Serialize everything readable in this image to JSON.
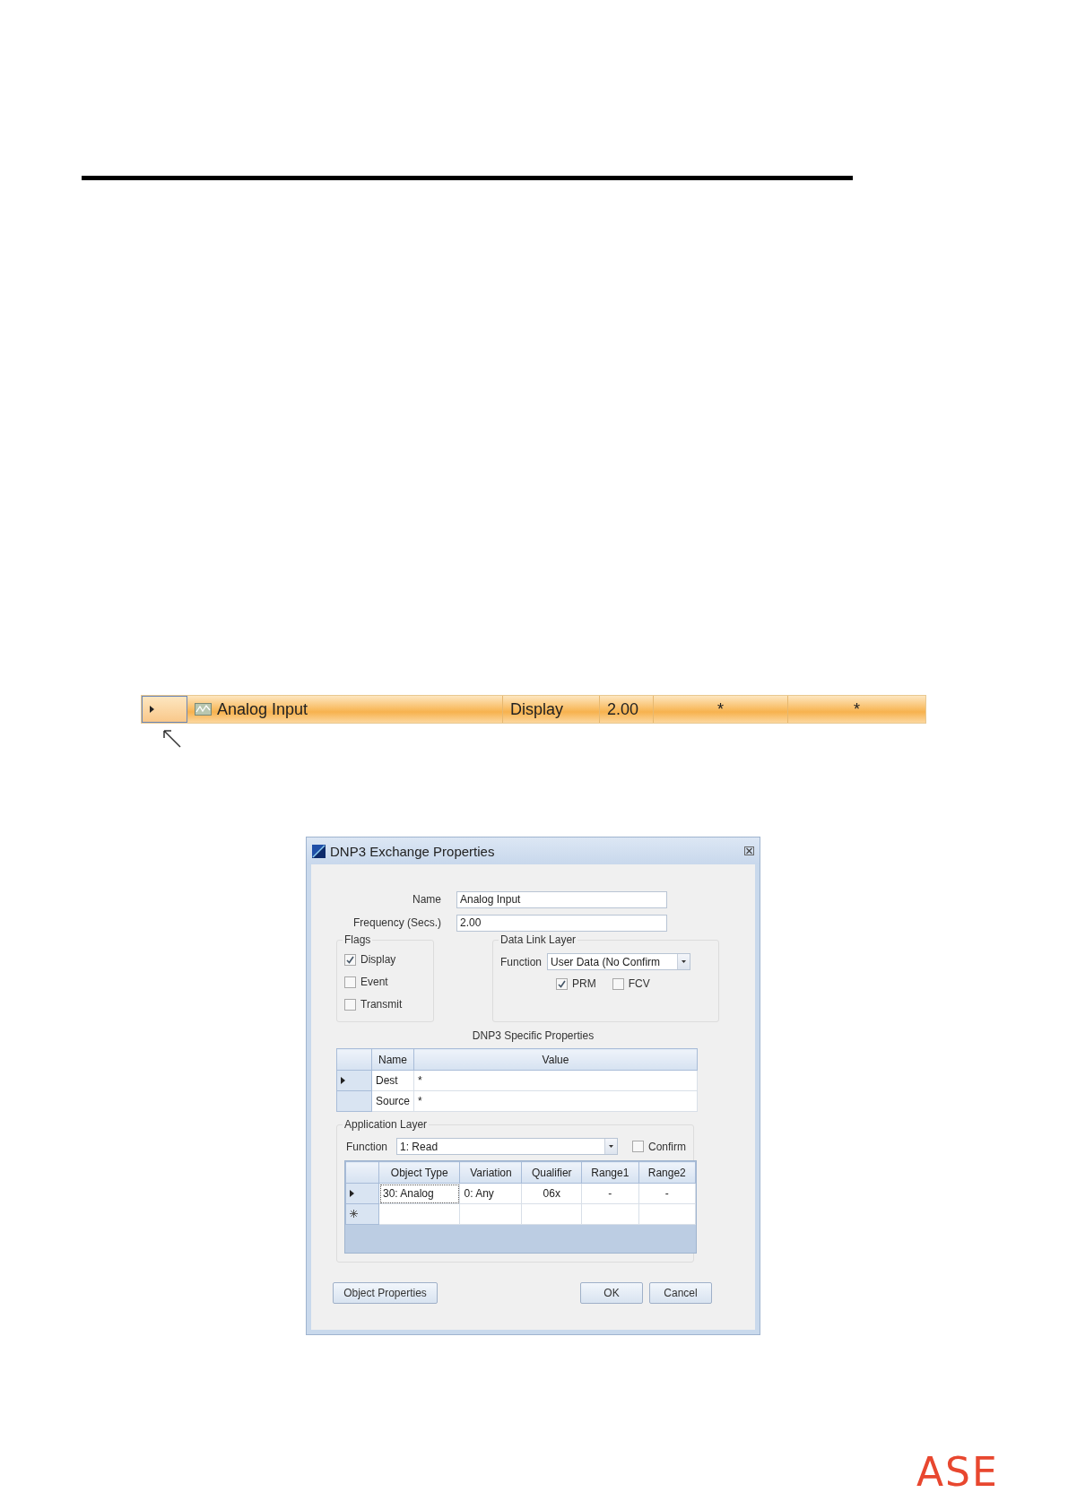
{
  "grid_row": {
    "selected": true,
    "name": "Analog Input",
    "mode": "Display",
    "frequency": "2.00",
    "column_5": "*",
    "column_6": "*"
  },
  "dialog": {
    "title": "DNP3 Exchange Properties",
    "name_label": "Name",
    "name_value": "Analog Input",
    "frequency_label": "Frequency (Secs.)",
    "frequency_value": "2.00",
    "flags": {
      "title": "Flags",
      "items": [
        {
          "label": "Display",
          "checked": true
        },
        {
          "label": "Event",
          "checked": false
        },
        {
          "label": "Transmit",
          "checked": false
        }
      ]
    },
    "data_link_layer": {
      "title": "Data Link Layer",
      "function_label": "Function",
      "function_value": "User Data (No Confirm",
      "options": [
        {
          "label": "PRM",
          "checked": true
        },
        {
          "label": "FCV",
          "checked": false
        }
      ]
    },
    "specific_properties": {
      "title": "DNP3 Specific Properties",
      "columns": [
        "Name",
        "Value"
      ],
      "rows": [
        {
          "name": "Dest",
          "value": "*",
          "selected": true
        },
        {
          "name": "Source",
          "value": "*",
          "selected": false
        }
      ]
    },
    "application_layer": {
      "title": "Application Layer",
      "function_label": "Function",
      "function_value": "1: Read",
      "confirm": {
        "label": "Confirm",
        "checked": false
      },
      "columns": [
        "Object Type",
        "Variation",
        "Qualifier",
        "Range1",
        "Range2"
      ],
      "rows": [
        {
          "cells": [
            "30: Analog",
            "0: Any",
            "06x",
            "-",
            "-"
          ],
          "selected": true
        }
      ]
    },
    "buttons": {
      "object_properties": "Object Properties",
      "ok": "OK",
      "cancel": "Cancel"
    }
  },
  "logo": "ASE"
}
